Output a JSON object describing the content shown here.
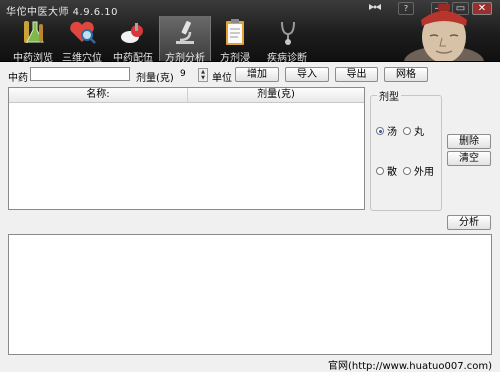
{
  "window": {
    "title": "华佗中医大师 4.9.6.10",
    "controls": {
      "skin_icon": "bow-tie-icon",
      "help": "?",
      "minimize": "—",
      "maximize": "▭",
      "close": "✕"
    }
  },
  "nav": {
    "tabs": [
      {
        "label": "中药浏览",
        "icon": "flask-icon",
        "active": false
      },
      {
        "label": "三维穴位",
        "icon": "heart-search-icon",
        "active": false
      },
      {
        "label": "中药配伍",
        "icon": "pills-icon",
        "active": false
      },
      {
        "label": "方剂分析",
        "icon": "microscope-icon",
        "active": true
      },
      {
        "label": "方剂浸",
        "icon": "clipboard-icon",
        "active": false
      },
      {
        "label": "疾病诊断",
        "icon": "stethoscope-icon",
        "active": false
      }
    ]
  },
  "form": {
    "herb_label": "中药",
    "herb_value": "",
    "dose_label": "剂量(克)",
    "dose_value": "9",
    "unit_label": "单位",
    "buttons": {
      "add": "增加",
      "import": "导入",
      "export": "导出",
      "grid": "网格"
    }
  },
  "table": {
    "columns": [
      "名称:",
      "剂量(克)"
    ],
    "rows": []
  },
  "dosage_form": {
    "title": "剂型",
    "options": [
      {
        "label": "汤",
        "selected": true
      },
      {
        "label": "丸",
        "selected": false
      },
      {
        "label": "散",
        "selected": false
      },
      {
        "label": "外用",
        "selected": false
      }
    ]
  },
  "side_buttons": {
    "delete": "删除",
    "clear": "清空",
    "analyze": "分析"
  },
  "output_text": "",
  "footer": {
    "website": "官网(http://www.huatuo007.com)"
  },
  "colors": {
    "header": "#1d1d1d",
    "accent": "#1b5fb3"
  }
}
